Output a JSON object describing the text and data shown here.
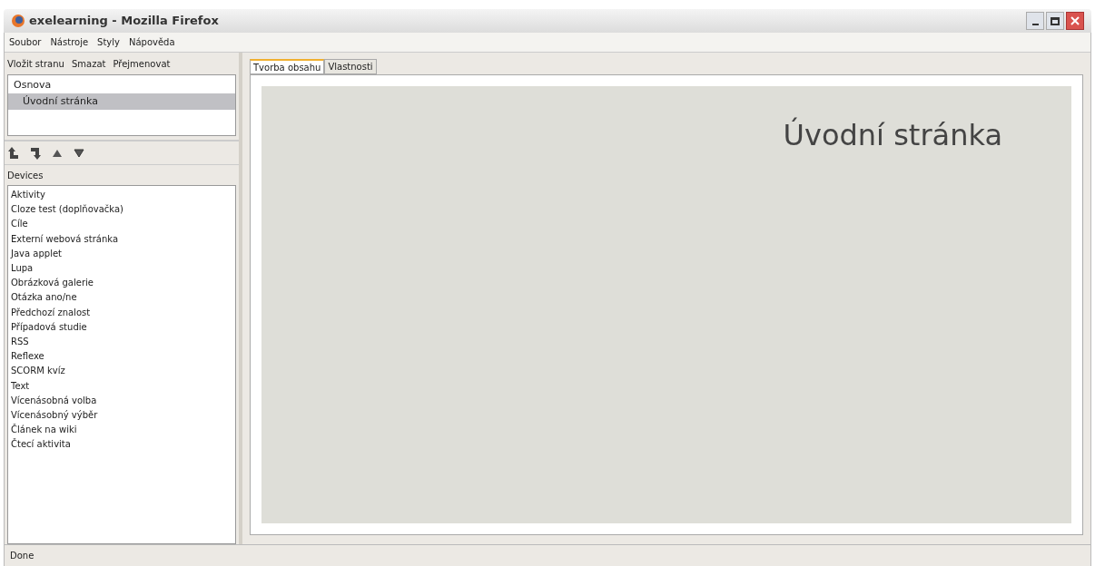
{
  "window": {
    "title": "exelearning - Mozilla Firefox"
  },
  "menu": [
    "Soubor",
    "Nástroje",
    "Styly",
    "Nápověda"
  ],
  "outline_toolbar": [
    "Vložit stranu",
    "Smazat",
    "Přejmenovat"
  ],
  "outline": [
    {
      "label": "Osnova",
      "selected": false,
      "children": [
        {
          "label": "Úvodní stránka",
          "selected": true
        }
      ]
    }
  ],
  "devices": {
    "title": "Devices",
    "items": [
      "Aktivity",
      "Cloze test (doplňovačka)",
      "Cíle",
      "Externí webová stránka",
      "Java applet",
      "Lupa",
      "Obrázková galerie",
      "Otázka ano/ne",
      "Předchozí znalost",
      "Případová studie",
      "RSS",
      "Reflexe",
      "SCORM kvíz",
      "Text",
      "Vícenásobná volba",
      "Vícenásobný výběr",
      "Článek na wiki",
      "Čtecí aktivita"
    ]
  },
  "tabs": [
    {
      "label": "Tvorba obsahu",
      "selected": true
    },
    {
      "label": "Vlastnosti",
      "selected": false
    }
  ],
  "page": {
    "heading": "Úvodní stránka"
  },
  "status_bar": "Done"
}
